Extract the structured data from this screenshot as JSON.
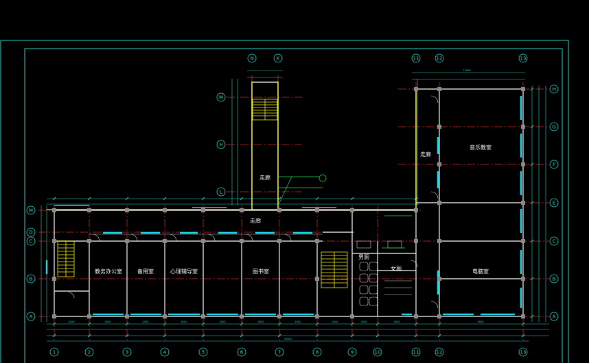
{
  "drawing": {
    "colors": {
      "background": "#000000",
      "frame": "#2cd3c3",
      "wall": "#d6d6d6",
      "axis_line": "#d62c2c",
      "window": "#19d9ef",
      "dimension": "#2fd5c4",
      "column": "#8a8a8a",
      "stair": "#f3f30a",
      "outline": "#ffff33",
      "door": "#e8e8e8",
      "callout": "#1fe04f",
      "text": "#f2f2f2",
      "wall_accent": "#d23fd2"
    },
    "rooms": {
      "teacher_office": "教务办公室",
      "storage": "备用室",
      "counseling_room": "心理辅导室",
      "library": "图书室",
      "corridor_main": "走廊",
      "corridor_north": "走廊",
      "corridor_east": "走廊",
      "music_room": "音乐教室",
      "computer_room": "电脑室",
      "toilet_m": "男厕",
      "toilet_w": "女厕"
    },
    "bottom_axes": [
      "1",
      "2",
      "3",
      "4",
      "5",
      "6",
      "7",
      "8",
      "9",
      "10",
      "11",
      "12",
      "13"
    ],
    "left_axes": [
      "A",
      "B",
      "C",
      "D",
      "M"
    ],
    "right_axes": [
      "H",
      "G",
      "F",
      "E",
      "C",
      "B",
      "A"
    ],
    "north_top_axes": [
      "N",
      "K"
    ],
    "north_left_axes": [
      "M",
      "H",
      "L"
    ],
    "east_top_axes": [
      "11",
      "12",
      "13"
    ]
  }
}
